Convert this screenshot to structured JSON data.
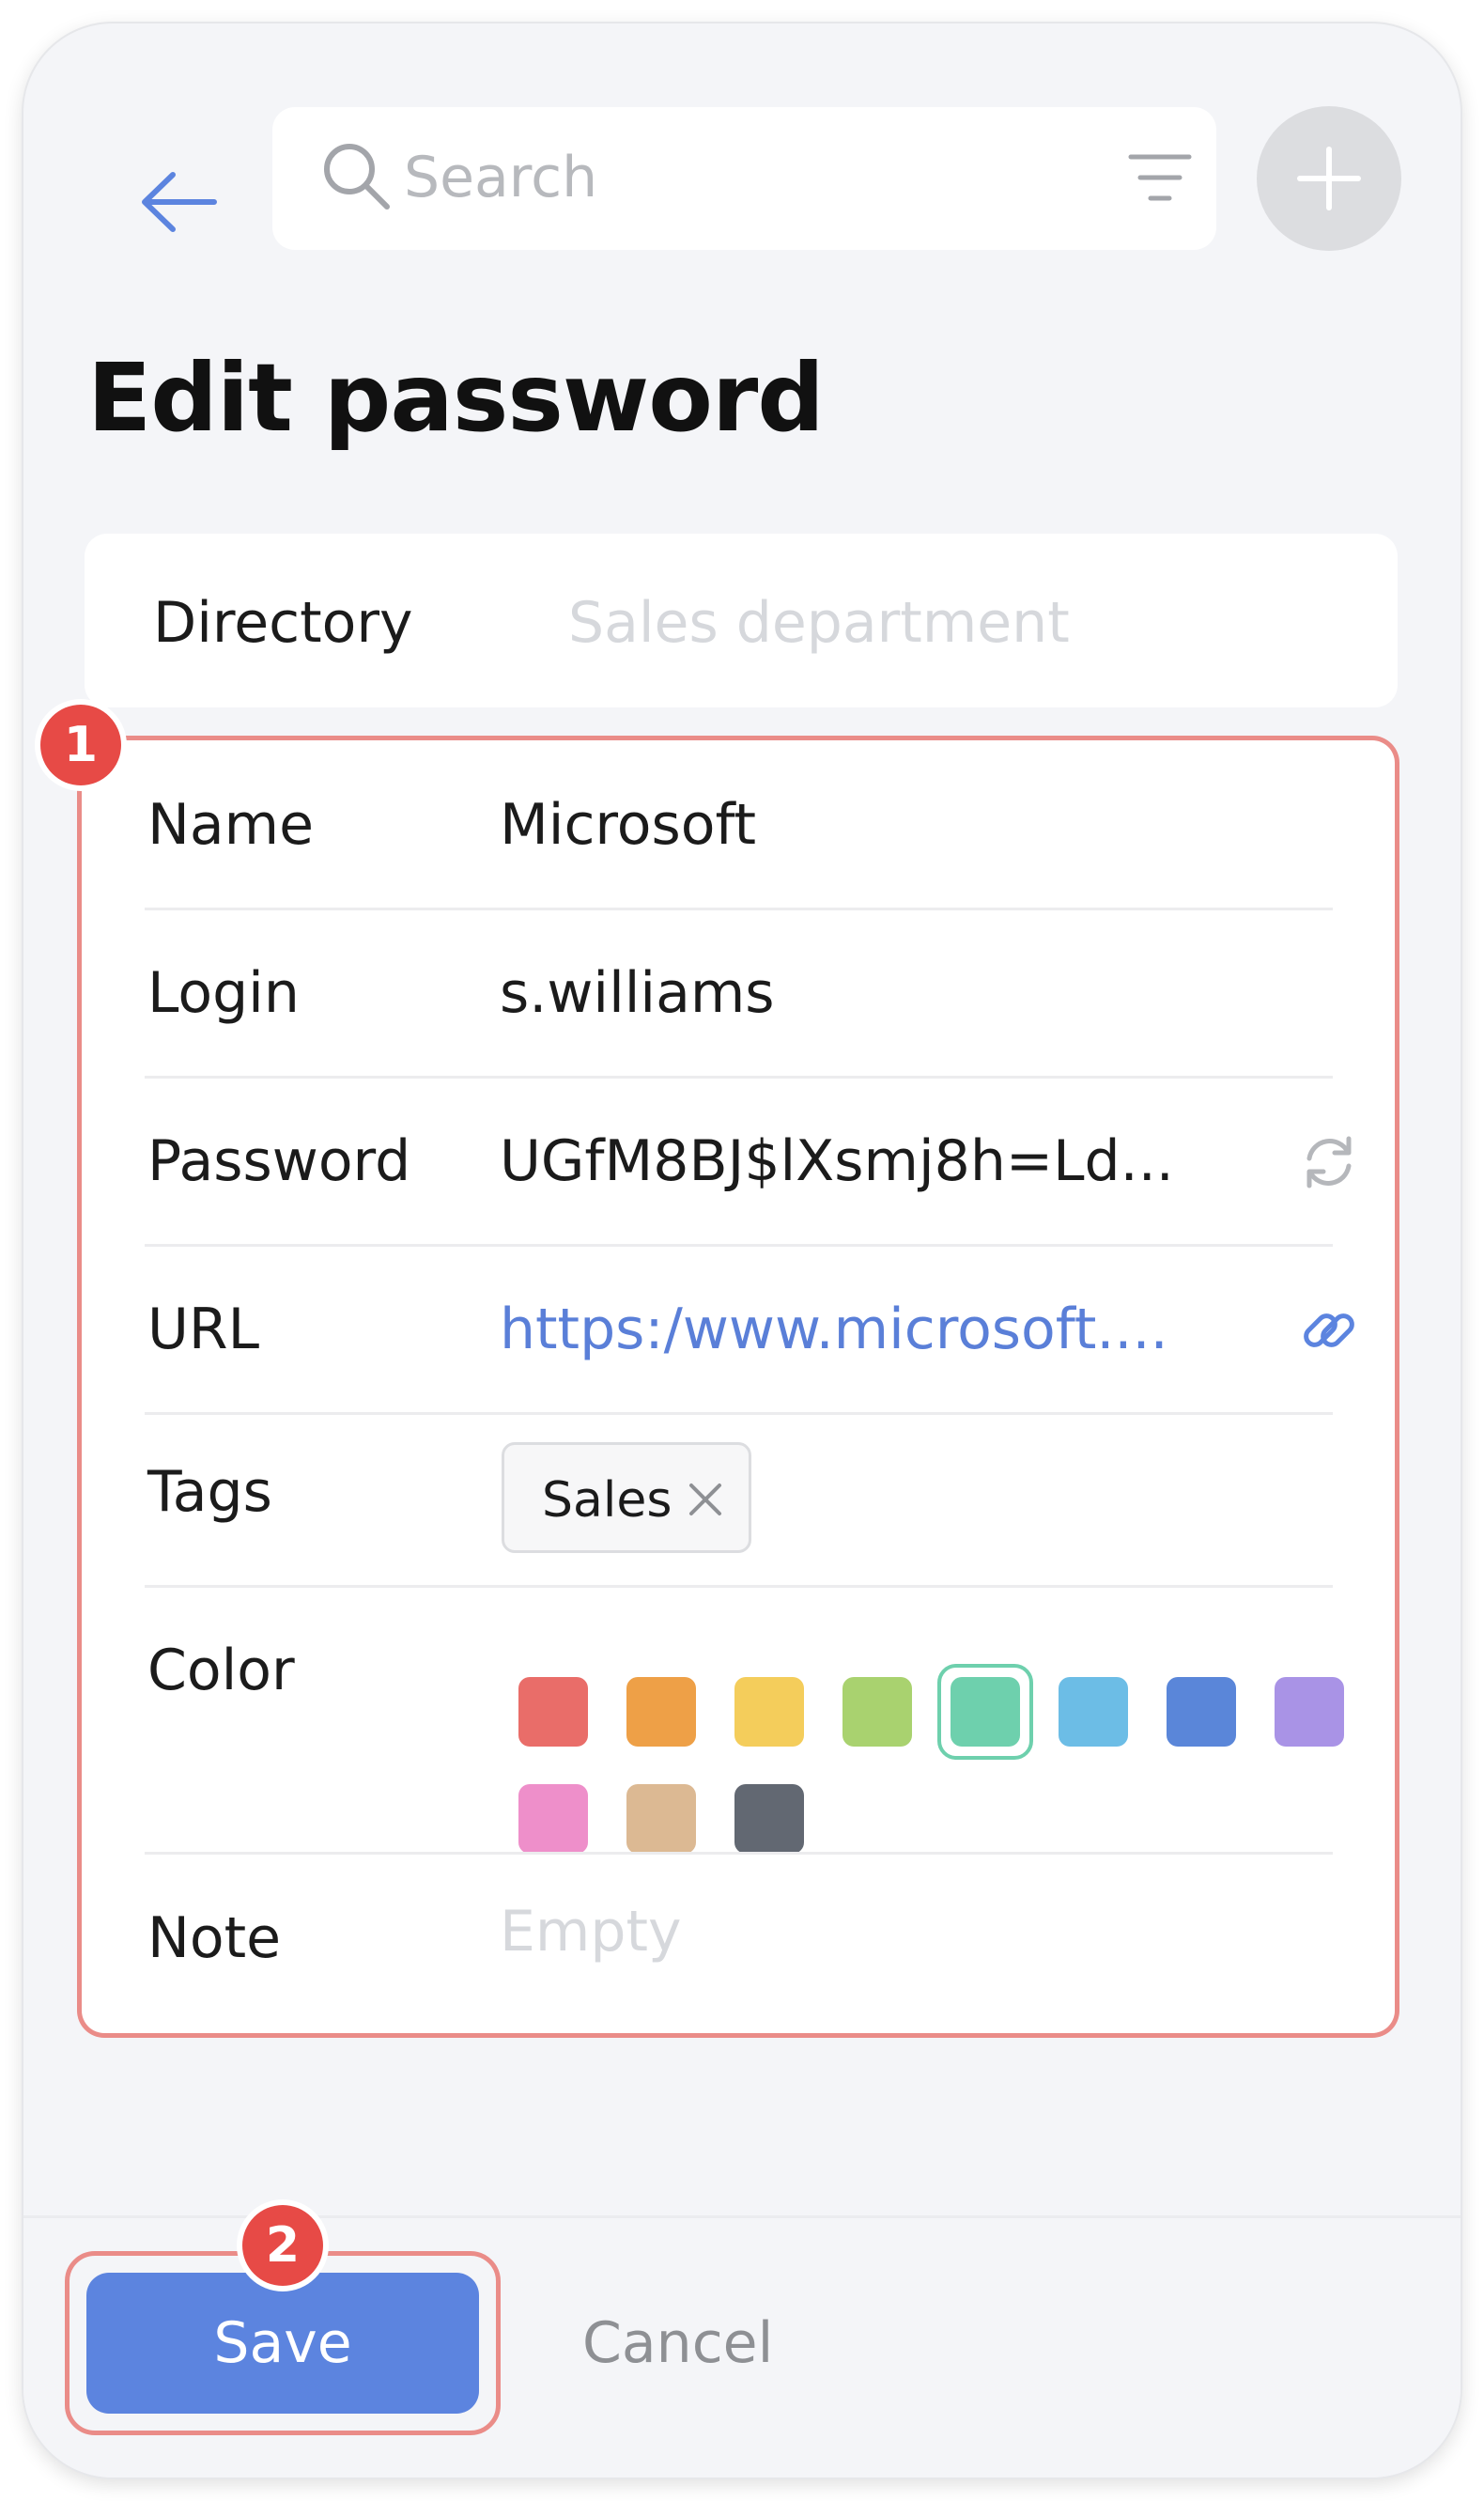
{
  "header": {
    "back_icon": "arrow-left-icon",
    "search": {
      "placeholder": "Search",
      "value": "",
      "icon": "search-icon",
      "filter_icon": "filter-icon"
    },
    "add_icon": "plus-icon"
  },
  "page": {
    "title": "Edit password"
  },
  "directory": {
    "label": "Directory",
    "value": "Sales department"
  },
  "form": {
    "name": {
      "label": "Name",
      "value": "Microsoft"
    },
    "login": {
      "label": "Login",
      "value": "s.williams"
    },
    "password": {
      "label": "Password",
      "value": "UGfM8BJ$lXsmj8h=Ld...",
      "icon": "refresh-icon"
    },
    "url": {
      "label": "URL",
      "value": "https:/www.microsoft....",
      "icon": "link-icon"
    },
    "tags": {
      "label": "Tags",
      "items": [
        {
          "text": "Sales",
          "remove_icon": "close-icon"
        }
      ]
    },
    "color": {
      "label": "Color",
      "swatches": [
        "#e96d69",
        "#eea047",
        "#f4cd5b",
        "#a9d26f",
        "#6ed0ad",
        "#6cbde6",
        "#5a86d9",
        "#a993e6",
        "#ee8fca",
        "#dcb993",
        "#626872"
      ],
      "selected": "#6ed0ad"
    },
    "note": {
      "label": "Note",
      "placeholder": "Empty"
    }
  },
  "badges": {
    "first": "1",
    "second": "2"
  },
  "highlight_color": "#ea8c88",
  "accent_color": "#5c84df",
  "actions": {
    "save_label": "Save",
    "cancel_label": "Cancel"
  }
}
